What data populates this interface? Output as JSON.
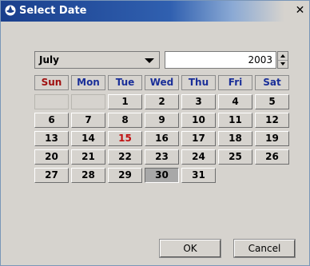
{
  "window": {
    "title": "Select Date",
    "close_glyph": "✕"
  },
  "controls": {
    "month": "July",
    "year": "2003"
  },
  "calendar": {
    "weekdays": [
      "Sun",
      "Mon",
      "Tue",
      "Wed",
      "Thu",
      "Fri",
      "Sat"
    ],
    "first_weekday_index": 2,
    "days_in_month": 31,
    "today": 15,
    "selected": 30,
    "day_labels": [
      "1",
      "2",
      "3",
      "4",
      "5",
      "6",
      "7",
      "8",
      "9",
      "10",
      "11",
      "12",
      "13",
      "14",
      "15",
      "16",
      "17",
      "18",
      "19",
      "20",
      "21",
      "22",
      "23",
      "24",
      "25",
      "26",
      "27",
      "28",
      "29",
      "30",
      "31"
    ]
  },
  "buttons": {
    "ok_label": "OK",
    "cancel_label": "Cancel"
  },
  "colors": {
    "weekday_header": "#1a2f99",
    "sunday_header": "#a01010",
    "today_text": "#c01010",
    "selected_bg": "#a8a8a8"
  }
}
